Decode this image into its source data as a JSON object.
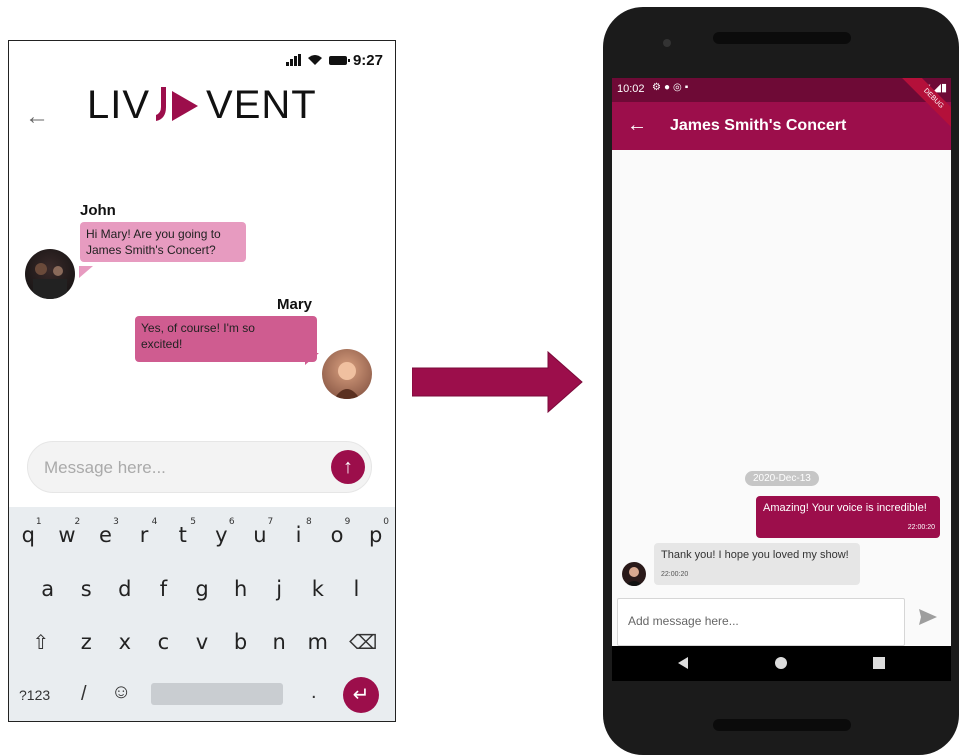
{
  "mockup": {
    "status_time": "9:27",
    "logo": {
      "left": "LIV",
      "right": "VENT"
    },
    "messages": [
      {
        "sender": "John",
        "text_line1": "Hi Mary! Are you going to",
        "text_line2": "James Smith's Concert?"
      },
      {
        "sender": "Mary",
        "text_line1": "Yes, of course! I'm so",
        "text_line2": "excited!"
      }
    ],
    "input_placeholder": "Message here...",
    "keyboard": {
      "row1": [
        "q",
        "w",
        "e",
        "r",
        "t",
        "y",
        "u",
        "i",
        "o",
        "p"
      ],
      "row1_digits": [
        "1",
        "2",
        "3",
        "4",
        "5",
        "6",
        "7",
        "8",
        "9",
        "0"
      ],
      "row2": [
        "a",
        "s",
        "d",
        "f",
        "g",
        "h",
        "j",
        "k",
        "l"
      ],
      "row3": [
        "z",
        "x",
        "c",
        "v",
        "b",
        "n",
        "m"
      ],
      "sym_label": "?123",
      "slash": "/",
      "period": "."
    },
    "colors": {
      "accent": "#9c0e4b",
      "john_bubble": "#e79bc0",
      "mary_bubble": "#cf5c90"
    }
  },
  "app": {
    "status_time": "10:02",
    "debug_banner": "DEBUG",
    "title": "James Smith's Concert",
    "date_chip": "2020-Dec-13",
    "outgoing": {
      "text": "Amazing! Your voice is incredible!",
      "time": "22:00:20"
    },
    "incoming": {
      "text": "Thank you! I hope you loved my show!",
      "time": "22:00:20"
    },
    "input_placeholder": "Add message here...",
    "colors": {
      "app_bar": "#9c0e4b",
      "status_bar": "#6e0a36",
      "incoming_bubble": "#e6e6e6"
    }
  },
  "icons": [
    "back-arrow-icon",
    "send-icon",
    "shift-icon",
    "backspace-icon",
    "emoji-icon",
    "enter-icon",
    "nav-back-icon",
    "nav-home-icon",
    "nav-recents-icon"
  ]
}
